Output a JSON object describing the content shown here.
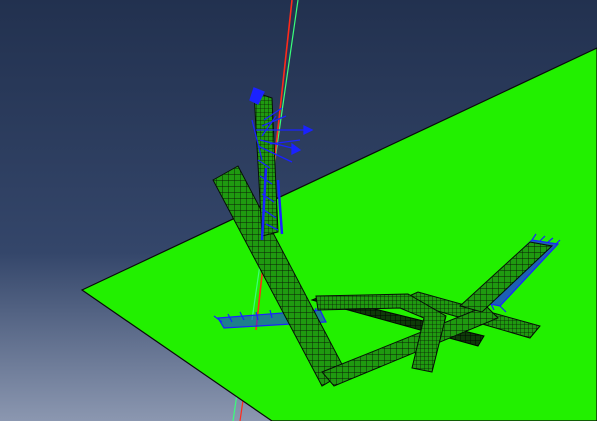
{
  "viewport": {
    "background_top": "#22314f",
    "background_mid": "#34466a",
    "background_bottom": "#8b97b0"
  },
  "scene": {
    "ground_plane_color": "#22f000",
    "mesh_fill_color": "#1f9a10",
    "mesh_line_color": "#0b1a06",
    "load_arrow_color": "#1a22ff",
    "axis_red_color": "#ff2a1a",
    "axis_green_color": "#39ff7a"
  }
}
